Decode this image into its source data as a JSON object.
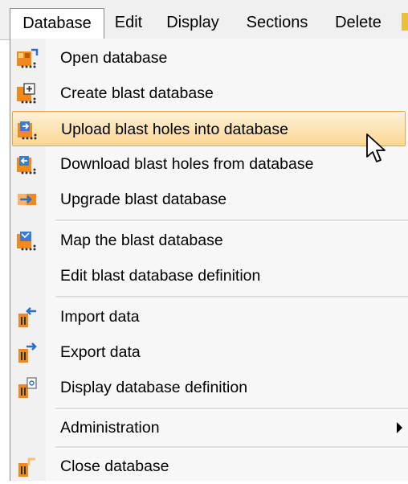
{
  "menubar": {
    "items": [
      {
        "label": "Database"
      },
      {
        "label": "Edit"
      },
      {
        "label": "Display"
      },
      {
        "label": "Sections"
      },
      {
        "label": "Delete"
      }
    ]
  },
  "menu": {
    "items": [
      {
        "label": "Open database",
        "icon": "open-database-icon"
      },
      {
        "label": "Create blast database",
        "icon": "create-database-icon"
      },
      {
        "label": "Upload blast holes into database",
        "icon": "upload-holes-icon",
        "highlighted": true
      },
      {
        "label": "Download blast holes from database",
        "icon": "download-holes-icon"
      },
      {
        "label": "Upgrade blast database",
        "icon": "upgrade-database-icon"
      },
      {
        "label": "Map the blast database",
        "icon": "map-database-icon"
      },
      {
        "label": "Edit blast database definition",
        "icon": null
      },
      {
        "label": "Import data",
        "icon": "import-data-icon"
      },
      {
        "label": "Export data",
        "icon": "export-data-icon"
      },
      {
        "label": "Display database definition",
        "icon": "display-definition-icon"
      },
      {
        "label": "Administration",
        "icon": null,
        "submenu": true
      },
      {
        "label": "Close database",
        "icon": "close-database-icon"
      }
    ]
  },
  "colors": {
    "highlight_top": "#fdf1d8",
    "highlight_bottom": "#fbd793",
    "highlight_border": "#e7a643",
    "icon_orange": "#f08a1e",
    "icon_blue": "#3a7bd5"
  }
}
